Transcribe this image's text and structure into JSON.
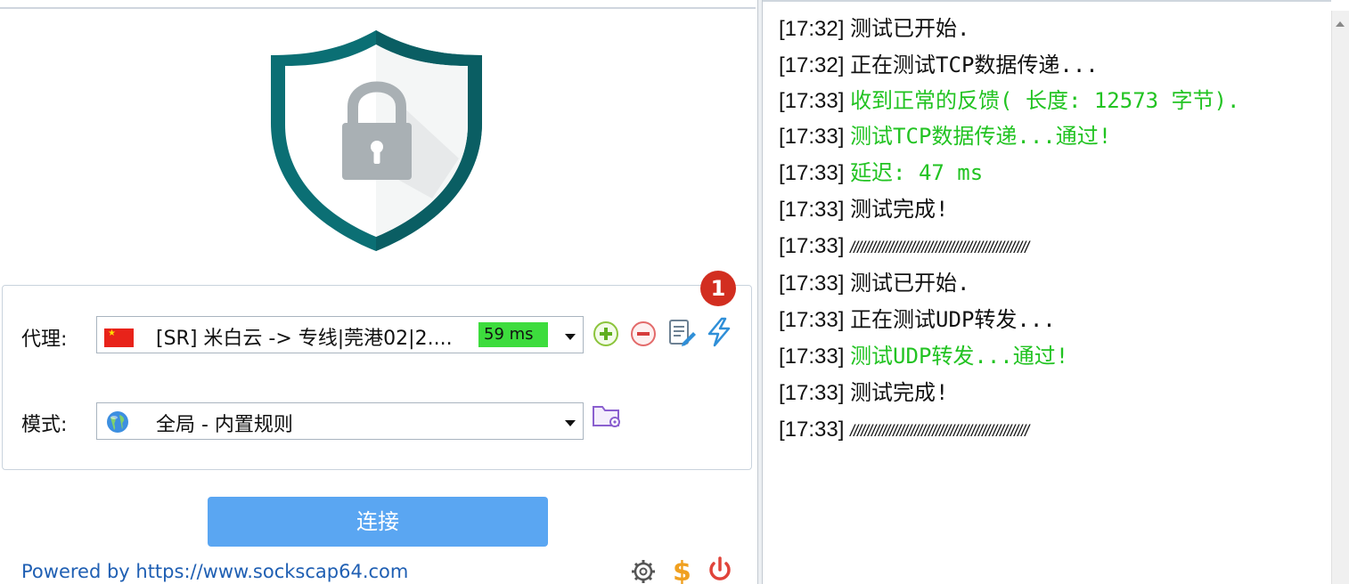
{
  "proxy": {
    "label": "代理:",
    "server_name": "[SR] 米白云 -> 专线|莞港02|2....",
    "latency": "59 ms"
  },
  "mode": {
    "label": "模式:",
    "value": "全局 - 内置规则"
  },
  "badge": {
    "number": "1"
  },
  "connect_button": {
    "label": "连接"
  },
  "footer": {
    "powered_by": "Powered by https://www.sockscap64.com"
  },
  "colors": {
    "accent_blue": "#5aa6f2",
    "success_green": "#22c322",
    "latency_green": "#3ddc3d",
    "badge_red": "#d22e20",
    "shield_teal": "#1a9a9a"
  },
  "log": [
    {
      "time": "[17:32]",
      "text": "测试已开始.",
      "status": "normal"
    },
    {
      "time": "[17:32]",
      "text": "正在测试TCP数据传递...",
      "status": "normal"
    },
    {
      "time": "[17:33]",
      "text": "收到正常的反馈( 长度: 12573 字节).",
      "status": "success"
    },
    {
      "time": "[17:33]",
      "text": "测试TCP数据传递...通过!",
      "status": "success"
    },
    {
      "time": "[17:33]",
      "text": "延迟: 47 ms",
      "status": "success"
    },
    {
      "time": "[17:33]",
      "text": "测试完成!",
      "status": "normal"
    },
    {
      "time": "[17:33]",
      "text": "//////////////////////////////////////////////////",
      "status": "normal"
    },
    {
      "time": "[17:33]",
      "text": "测试已开始.",
      "status": "normal"
    },
    {
      "time": "[17:33]",
      "text": "正在测试UDP转发...",
      "status": "normal"
    },
    {
      "time": "[17:33]",
      "text": "测试UDP转发...通过!",
      "status": "success"
    },
    {
      "time": "[17:33]",
      "text": "测试完成!",
      "status": "normal"
    },
    {
      "time": "[17:33]",
      "text": "//////////////////////////////////////////////////",
      "status": "normal"
    }
  ]
}
